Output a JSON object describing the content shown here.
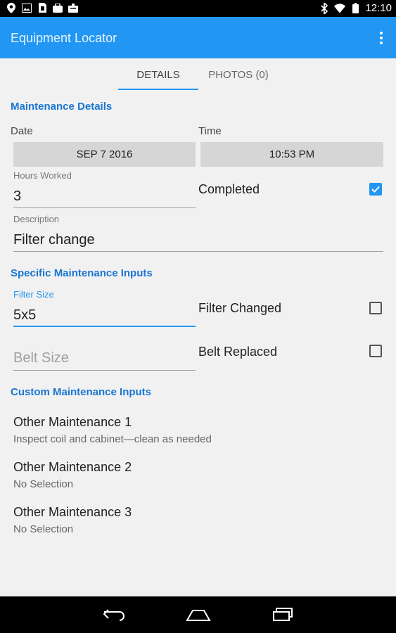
{
  "status_bar": {
    "time": "12:10",
    "left_icons": [
      "location-icon",
      "image-icon",
      "sim-icon",
      "bag-icon",
      "briefcase-icon"
    ],
    "right_icons": [
      "bluetooth-icon",
      "wifi-icon",
      "battery-icon"
    ]
  },
  "app_bar": {
    "title": "Equipment Locator",
    "menu_icon": "overflow-menu-icon"
  },
  "tabs": [
    {
      "label": "DETAILS",
      "active": true
    },
    {
      "label": "PHOTOS (0)",
      "active": false
    }
  ],
  "maintenance_details": {
    "header": "Maintenance Details",
    "date_label": "Date",
    "date_value": "SEP 7 2016",
    "time_label": "Time",
    "time_value": "10:53 PM",
    "hours_label": "Hours Worked",
    "hours_value": "3",
    "completed_label": "Completed",
    "completed_checked": true,
    "description_label": "Description",
    "description_value": "Filter change"
  },
  "specific_inputs": {
    "header": "Specific Maintenance Inputs",
    "filter_size_label": "Filter Size",
    "filter_size_value": "5x5",
    "filter_changed_label": "Filter Changed",
    "filter_changed_checked": false,
    "belt_size_placeholder": "Belt Size",
    "belt_replaced_label": "Belt Replaced",
    "belt_replaced_checked": false
  },
  "custom_inputs": {
    "header": "Custom Maintenance Inputs",
    "items": [
      {
        "title": "Other Maintenance 1",
        "value": "Inspect coil and cabinet—clean as needed"
      },
      {
        "title": "Other Maintenance 2",
        "value": "No Selection"
      },
      {
        "title": "Other Maintenance 3",
        "value": "No Selection"
      }
    ]
  },
  "nav_bar": {
    "icons": [
      "back-icon",
      "home-icon",
      "recents-icon"
    ]
  },
  "colors": {
    "accent": "#2196f3",
    "header_text": "#1976d2",
    "background": "#f1f1f1"
  }
}
